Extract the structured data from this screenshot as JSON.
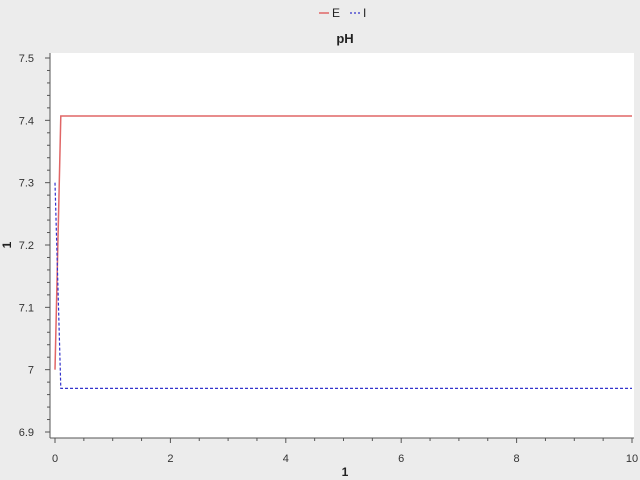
{
  "chart_data": {
    "type": "line",
    "title": "pH",
    "xlabel": "1",
    "ylabel": "1",
    "xlim": [
      0,
      10
    ],
    "ylim": [
      6.9,
      7.5
    ],
    "xticks": [
      "0",
      "2",
      "4",
      "6",
      "8",
      "10"
    ],
    "yticks": [
      "6.9",
      "7",
      "7.1",
      "7.2",
      "7.3",
      "7.4",
      "7.5"
    ],
    "grid": false,
    "legend_position": "top-center",
    "series": [
      {
        "name": "E",
        "color": "#e06666",
        "dash": "solid",
        "x": [
          0,
          0.1,
          10
        ],
        "y": [
          7.0,
          7.407,
          7.407
        ]
      },
      {
        "name": "I",
        "color": "#3333cc",
        "dash": "dashed",
        "x": [
          0,
          0.1,
          10
        ],
        "y": [
          7.3,
          6.97,
          6.97
        ]
      }
    ]
  }
}
